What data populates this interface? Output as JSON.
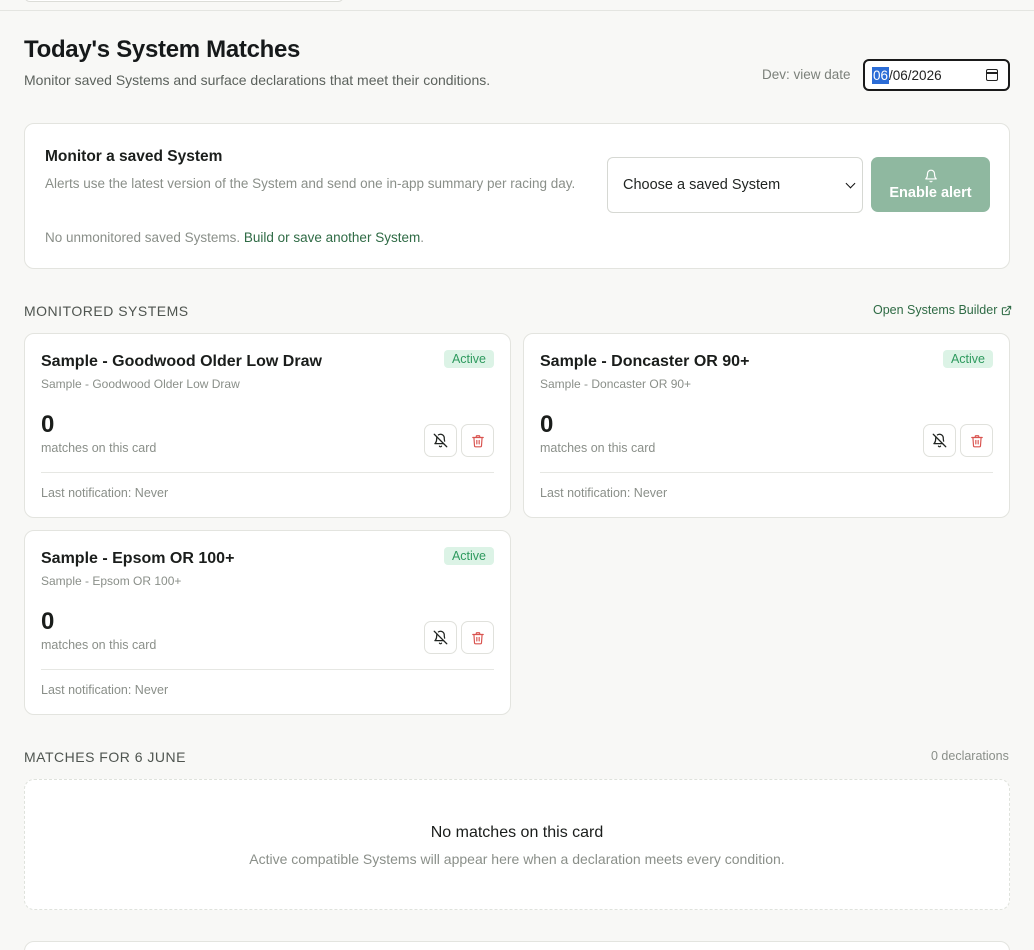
{
  "header": {
    "title": "Today's System Matches",
    "subtitle": "Monitor saved Systems and surface declarations that meet their conditions.",
    "dev_label": "Dev: view date",
    "date": {
      "day": "06",
      "rest": "/06/2026"
    }
  },
  "monitor": {
    "title": "Monitor a saved System",
    "description": "Alerts use the latest version of the System and send one in-app summary per racing day.",
    "note": "No unmonitored saved Systems.",
    "link": "Build or save another System",
    "link_suffix": ".",
    "select_value": "Choose a saved System",
    "button_label": "Enable alert"
  },
  "monitored": {
    "section_label": "MONITORED SYSTEMS",
    "builder_link": "Open Systems Builder",
    "systems": [
      {
        "name": "Sample - Goodwood Older Low Draw",
        "subtitle": "Sample - Goodwood Older Low Draw",
        "status": "Active",
        "count": "0",
        "count_label": "matches on this card",
        "last_notification": "Last notification: Never"
      },
      {
        "name": "Sample - Doncaster OR 90+",
        "subtitle": "Sample - Doncaster OR 90+",
        "status": "Active",
        "count": "0",
        "count_label": "matches on this card",
        "last_notification": "Last notification: Never"
      },
      {
        "name": "Sample - Epsom OR 100+",
        "subtitle": "Sample - Epsom OR 100+",
        "status": "Active",
        "count": "0",
        "count_label": "matches on this card",
        "last_notification": "Last notification: Never"
      }
    ]
  },
  "matches": {
    "section_label": "MATCHES FOR 6 JUNE",
    "declarations": "0 declarations",
    "empty_title": "No matches on this card",
    "empty_subtitle": "Active compatible Systems will appear here when a declaration meets every condition."
  },
  "colors": {
    "accent_green": "#2f6b45",
    "button_green_disabled": "#8fb8a0",
    "badge_bg": "#dcf3e6",
    "badge_text": "#2e9a5e",
    "delete_red": "#d9534f"
  },
  "icons": {
    "bell": "bell-icon",
    "bell_off": "bell-off-icon",
    "trash": "trash-icon",
    "external_link": "external-link-icon",
    "calendar": "calendar-icon",
    "chevron": "chevron-down-icon"
  }
}
